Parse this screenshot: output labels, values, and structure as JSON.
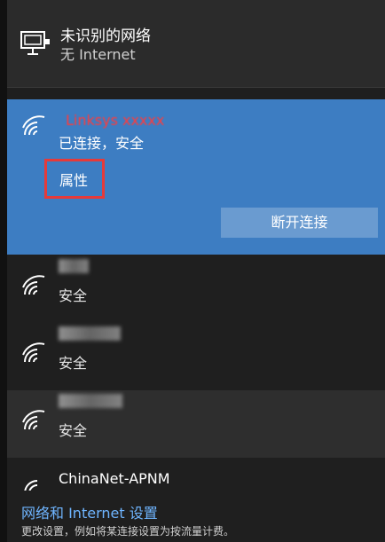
{
  "wired": {
    "title": "未识别的网络",
    "status": "无 Internet"
  },
  "connected": {
    "ssid": "Linksys xxxxx",
    "status": "已连接，安全",
    "properties_label": "属性",
    "disconnect_label": "断开连接"
  },
  "networks": [
    {
      "security": "安全"
    },
    {
      "security": "安全"
    },
    {
      "security": "安全"
    },
    {
      "name": "ChinaNet-APNM"
    }
  ],
  "footer": {
    "settings_link": "网络和 Internet 设置",
    "hint": "更改设置，例如将某连接设置为按流量计费。"
  },
  "colors": {
    "panel_bg": "#1f1f1f",
    "selected_bg": "#3d7dc2",
    "link": "#6fb5ff",
    "highlight_box": "#e63a3a"
  },
  "icons": {
    "wired": "ethernet-monitor-icon",
    "wifi": "wifi-signal-icon"
  }
}
